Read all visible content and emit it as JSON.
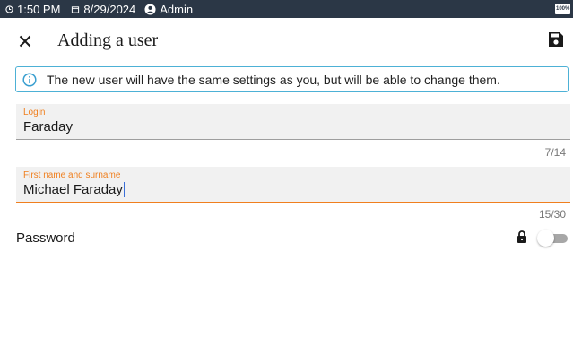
{
  "status_bar": {
    "time": "1:50 PM",
    "date": "8/29/2024",
    "user": "Admin",
    "battery": "100%"
  },
  "header": {
    "title": "Adding a user",
    "close_icon": "close-icon",
    "save_icon": "floppy-disk-icon"
  },
  "info_banner": {
    "icon": "info-circle-icon",
    "text": "The new user will have the same settings as you, but will be able to change them."
  },
  "fields": {
    "login": {
      "label": "Login",
      "value": "Faraday",
      "counter": "7/14"
    },
    "name": {
      "label": "First name and surname",
      "value": "Michael Faraday",
      "counter": "15/30"
    }
  },
  "password": {
    "label": "Password",
    "icon": "lock-icon",
    "enabled": false
  },
  "colors": {
    "status_bar_bg": "#2b3746",
    "accent_orange": "#f07f1e",
    "info_blue": "#4db1d6",
    "field_bg": "#f1f1f1"
  }
}
